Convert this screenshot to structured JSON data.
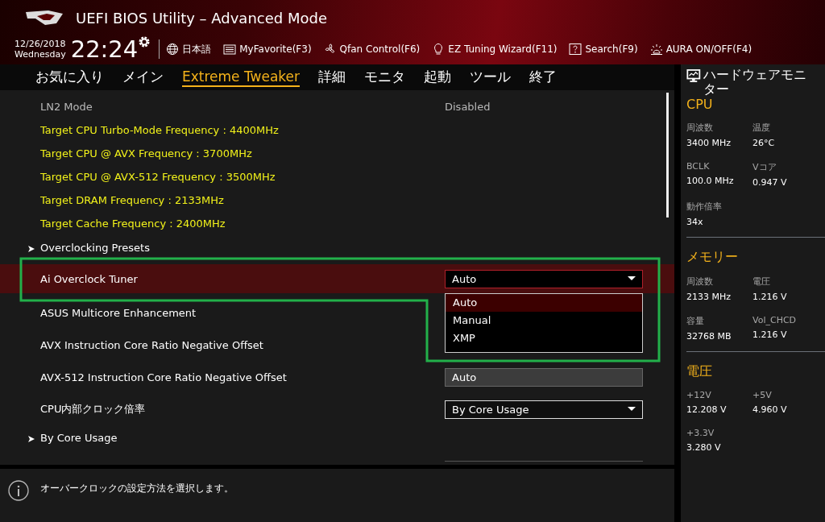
{
  "header": {
    "title": "UEFI BIOS Utility – Advanced Mode",
    "date": "12/26/2018",
    "weekday": "Wednesday",
    "time": "22:24",
    "tools": [
      {
        "kind": "globe",
        "label": "日本語"
      },
      {
        "kind": "list",
        "label": "MyFavorite(F3)"
      },
      {
        "kind": "fan",
        "label": "Qfan Control(F6)"
      },
      {
        "kind": "bulb",
        "label": "EZ Tuning Wizard(F11)"
      },
      {
        "kind": "help",
        "label": "Search(F9)"
      },
      {
        "kind": "aura",
        "label": "AURA ON/OFF(F4)"
      }
    ]
  },
  "tabs": [
    {
      "label": "お気に入り",
      "selected": false
    },
    {
      "label": "メイン",
      "selected": false
    },
    {
      "label": "Extreme Tweaker",
      "selected": true
    },
    {
      "label": "詳細",
      "selected": false
    },
    {
      "label": "モニタ",
      "selected": false
    },
    {
      "label": "起動",
      "selected": false
    },
    {
      "label": "ツール",
      "selected": false
    },
    {
      "label": "終了",
      "selected": false
    }
  ],
  "settings": [
    {
      "kind": "info",
      "label": "LN2 Mode",
      "value": "Disabled",
      "selected": false
    },
    {
      "kind": "target",
      "label": "Target CPU Turbo-Mode Frequency : 4400MHz",
      "selected": false
    },
    {
      "kind": "target",
      "label": "Target CPU @ AVX Frequency : 3700MHz",
      "selected": false
    },
    {
      "kind": "target",
      "label": "Target CPU @ AVX-512 Frequency : 3500MHz",
      "selected": false
    },
    {
      "kind": "target",
      "label": "Target DRAM Frequency : 2133MHz",
      "selected": false
    },
    {
      "kind": "target",
      "label": "Target Cache Frequency : 2400MHz",
      "selected": false
    },
    {
      "kind": "submenu",
      "label": "Overclocking Presets",
      "selected": false
    },
    {
      "kind": "select",
      "label": "Ai Overclock Tuner",
      "value": "Auto",
      "selected": true
    },
    {
      "kind": "hidden",
      "label": "ASUS Multicore Enhancement",
      "selected": false
    },
    {
      "kind": "hidden",
      "label": "AVX Instruction Core Ratio Negative Offset",
      "selected": false
    },
    {
      "kind": "field",
      "label": "AVX-512 Instruction Core Ratio Negative Offset",
      "value": "Auto",
      "selected": false
    },
    {
      "kind": "select",
      "label": "CPU内部クロック倍率",
      "value": "By Core Usage",
      "selected": false
    },
    {
      "kind": "submenu",
      "label": "By Core Usage",
      "selected": false
    }
  ],
  "dropdown": {
    "options": [
      {
        "label": "Auto",
        "selected": true
      },
      {
        "label": "Manual",
        "selected": false
      },
      {
        "label": "XMP",
        "selected": false
      }
    ]
  },
  "help": "オーバークロックの設定方法を選択します。",
  "monitor": {
    "title": "ハードウェアモニター",
    "sections": [
      {
        "title": "CPU",
        "items": [
          {
            "label": "周波数",
            "value": "3400 MHz"
          },
          {
            "label": "温度",
            "value": "26°C"
          },
          {
            "label": "BCLK",
            "value": "100.0 MHz"
          },
          {
            "label": "Vコア",
            "value": "0.947 V"
          },
          {
            "label": "動作倍率",
            "value": "34x"
          }
        ]
      },
      {
        "title": "メモリー",
        "items": [
          {
            "label": "周波数",
            "value": "2133 MHz"
          },
          {
            "label": "電圧",
            "value": "1.216 V"
          },
          {
            "label": "容量",
            "value": "32768 MB"
          },
          {
            "label": "Vol_CHCD",
            "value": "1.216 V"
          }
        ]
      },
      {
        "title": "電圧",
        "items": [
          {
            "label": "+12V",
            "value": "12.208 V"
          },
          {
            "label": "+5V",
            "value": "4.960 V"
          },
          {
            "label": "+3.3V",
            "value": "3.280 V"
          }
        ]
      }
    ]
  }
}
